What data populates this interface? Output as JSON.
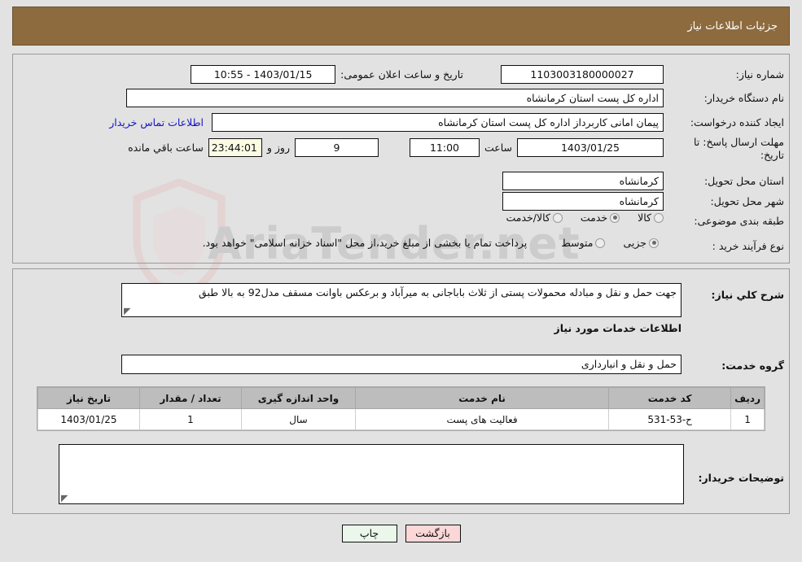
{
  "header": {
    "title": "جزئیات اطلاعات نیاز",
    "bar_color": "#8d6b3e"
  },
  "watermark": {
    "text": "AriaTender.net"
  },
  "top_panel": {
    "need_number": {
      "label": "شماره نیاز:",
      "value": "1103003180000027"
    },
    "public_announce": {
      "label": "تاریخ و ساعت اعلان عمومی:",
      "value": "1403/01/15 - 10:55"
    },
    "buyer_org": {
      "label": "نام دستگاه خریدار:",
      "value": "اداره کل پست استان کرمانشاه"
    },
    "requester": {
      "label": "ایجاد کننده درخواست:",
      "value": "پیمان امانی کاربرداز اداره کل پست استان کرمانشاه",
      "link": "اطلاعات تماس خریدار"
    },
    "deadline": {
      "label": "مهلت ارسال پاسخ: تا تاریخ:",
      "date": "1403/01/25",
      "time_label": "ساعت",
      "time": "11:00",
      "days": "9",
      "days_label": "روز و",
      "countdown": "23:44:01",
      "countdown_label": "ساعت باقي مانده"
    },
    "delivery_province": {
      "label": "استان محل تحویل:",
      "value": "کرمانشاه"
    },
    "delivery_city": {
      "label": "شهر محل تحویل:",
      "value": "کرمانشاه"
    },
    "category": {
      "label": "طبقه بندی موضوعی:",
      "options": [
        {
          "label": "کالا",
          "selected": false
        },
        {
          "label": "خدمت",
          "selected": true
        },
        {
          "label": "کالا/خدمت",
          "selected": false
        }
      ]
    },
    "purchase_type": {
      "label": "نوع فرآیند خرید :",
      "options": [
        {
          "label": "جزیی",
          "selected": true
        },
        {
          "label": "متوسط",
          "selected": false
        }
      ],
      "note": "پرداخت تمام یا بخشی از مبلغ خرید،از محل \"اسناد خزانه اسلامی\" خواهد بود."
    }
  },
  "mid_panel": {
    "general_desc": {
      "label": "شرح كلي نياز:",
      "value": "جهت حمل و نقل و مبادله محمولات پستی  از ثلاث باباجانی به میرآباد و برعکس باوانت مسقف مدل92 به بالا طبق"
    },
    "services_heading": "اطلاعات خدمات مورد نیاز",
    "service_group": {
      "label": "گروه خدمت:",
      "value": "حمل و نقل و انبارداری"
    },
    "table": {
      "columns": [
        "ردیف",
        "کد خدمت",
        "نام خدمت",
        "واحد اندازه گیری",
        "تعداد / مقدار",
        "تاریخ نیاز"
      ],
      "rows": [
        [
          "1",
          "ح-53-531",
          "فعالیت های پست",
          "سال",
          "1",
          "1403/01/25"
        ]
      ]
    },
    "buyer_notes": {
      "label": "توضیحات خریدار:",
      "value": ""
    }
  },
  "buttons": {
    "print": "چاپ",
    "back": "بازگشت"
  }
}
